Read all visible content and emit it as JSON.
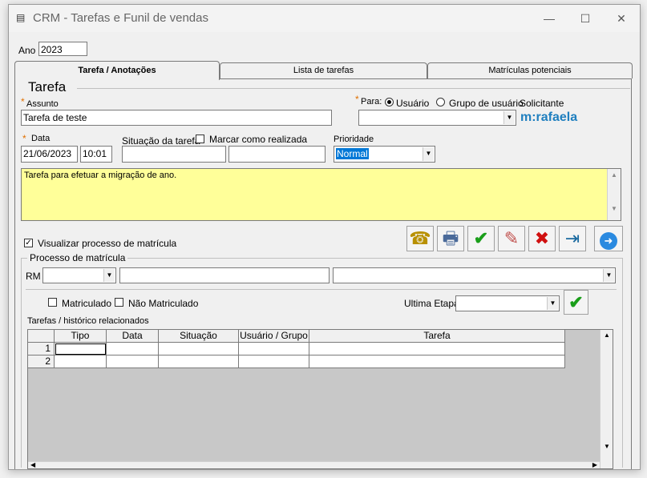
{
  "window": {
    "title": "CRM - Tarefas e Funil de vendas",
    "app_icon": "crm-app-icon",
    "minimize": "—",
    "maximize": "☐",
    "close": "✕"
  },
  "ano": {
    "label": "Ano",
    "value": "2023"
  },
  "tabs": [
    {
      "label": "Tarefa / Anotações"
    },
    {
      "label": "Lista de tarefas"
    },
    {
      "label": "Matrículas potenciais"
    }
  ],
  "tarefa": {
    "section_title": "Tarefa",
    "assunto": {
      "label": "Assunto",
      "value": "Tarefa de teste"
    },
    "para": {
      "label": "Para:",
      "opt_usuario": "Usuário",
      "opt_grupo": "Grupo de usuário",
      "solicitante_label": "Solicitante",
      "solicitante_value": "m:rafaela",
      "recipient": ""
    },
    "data": {
      "label": "Data",
      "date": "21/06/2023",
      "time": "10:01"
    },
    "situacao": {
      "label": "Situação da tarefa",
      "marcar_label": "Marcar como realizada",
      "field1": "",
      "field2": ""
    },
    "prioridade": {
      "label": "Prioridade",
      "value": "Normal"
    },
    "descricao": "Tarefa para efetuar a migração de ano.",
    "visualizar_label": "Visualizar processo de matrícula"
  },
  "toolbar": {
    "phone": "☎",
    "print": "🖶",
    "confirm": "✔",
    "eraser": "✎",
    "delete": "✖",
    "exit": "⇥",
    "next": "➜"
  },
  "processo": {
    "title": "Processo de matrícula",
    "rm_label": "RM",
    "rm_value": "",
    "name_value": "",
    "course_value": "",
    "matriculado_label": "Matriculado",
    "nao_matriculado_label": "Não Matriculado",
    "ultima_etapa_label": "Ultima Etapa",
    "ultima_etapa_value": ""
  },
  "historico": {
    "title": "Tarefas / histórico relacionados",
    "columns": [
      "Tipo",
      "Data",
      "Situação",
      "Usuário / Grupo",
      "Tarefa"
    ],
    "rows": [
      {
        "n": "1"
      },
      {
        "n": "2"
      }
    ]
  },
  "colors": {
    "note_bg": "#ffff99",
    "solicitante": "#1f7fbf",
    "required_star": "#e07000",
    "confirm_green": "#1a9e1a",
    "delete_red": "#d01010"
  }
}
